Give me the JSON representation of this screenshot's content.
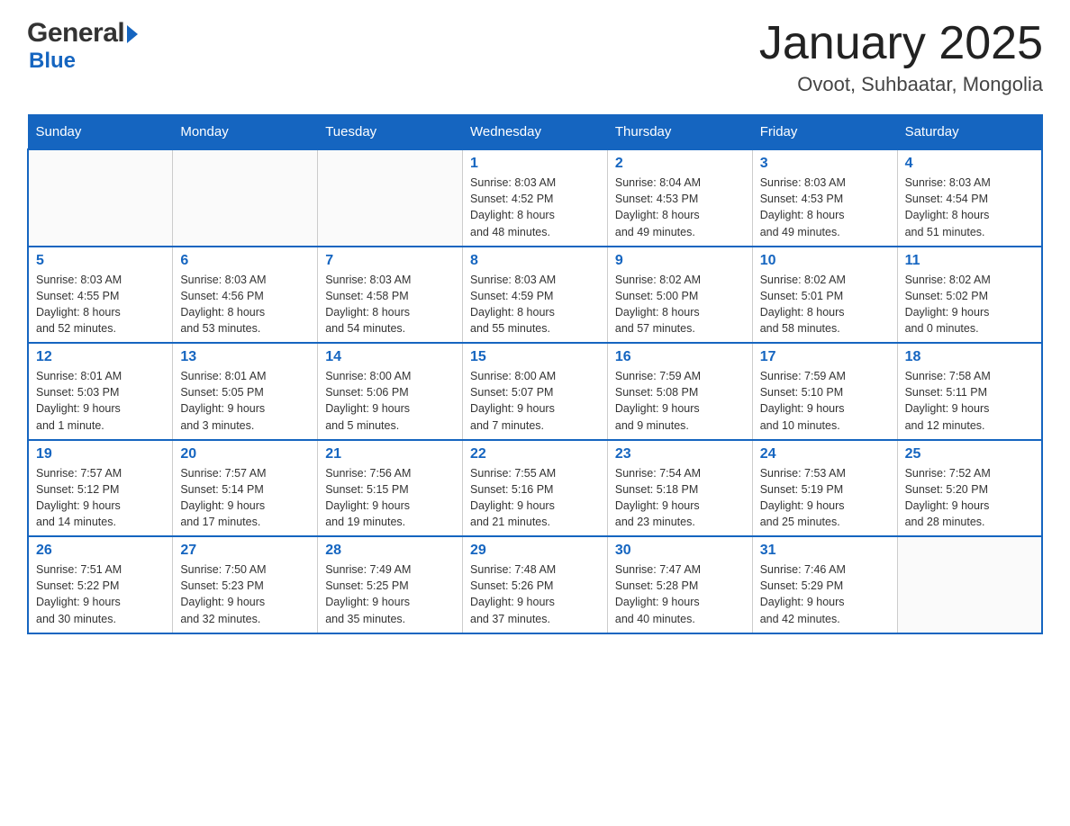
{
  "logo": {
    "general": "General",
    "blue": "Blue"
  },
  "title": "January 2025",
  "location": "Ovoot, Suhbaatar, Mongolia",
  "weekdays": [
    "Sunday",
    "Monday",
    "Tuesday",
    "Wednesday",
    "Thursday",
    "Friday",
    "Saturday"
  ],
  "weeks": [
    [
      {
        "day": "",
        "info": ""
      },
      {
        "day": "",
        "info": ""
      },
      {
        "day": "",
        "info": ""
      },
      {
        "day": "1",
        "info": "Sunrise: 8:03 AM\nSunset: 4:52 PM\nDaylight: 8 hours\nand 48 minutes."
      },
      {
        "day": "2",
        "info": "Sunrise: 8:04 AM\nSunset: 4:53 PM\nDaylight: 8 hours\nand 49 minutes."
      },
      {
        "day": "3",
        "info": "Sunrise: 8:03 AM\nSunset: 4:53 PM\nDaylight: 8 hours\nand 49 minutes."
      },
      {
        "day": "4",
        "info": "Sunrise: 8:03 AM\nSunset: 4:54 PM\nDaylight: 8 hours\nand 51 minutes."
      }
    ],
    [
      {
        "day": "5",
        "info": "Sunrise: 8:03 AM\nSunset: 4:55 PM\nDaylight: 8 hours\nand 52 minutes."
      },
      {
        "day": "6",
        "info": "Sunrise: 8:03 AM\nSunset: 4:56 PM\nDaylight: 8 hours\nand 53 minutes."
      },
      {
        "day": "7",
        "info": "Sunrise: 8:03 AM\nSunset: 4:58 PM\nDaylight: 8 hours\nand 54 minutes."
      },
      {
        "day": "8",
        "info": "Sunrise: 8:03 AM\nSunset: 4:59 PM\nDaylight: 8 hours\nand 55 minutes."
      },
      {
        "day": "9",
        "info": "Sunrise: 8:02 AM\nSunset: 5:00 PM\nDaylight: 8 hours\nand 57 minutes."
      },
      {
        "day": "10",
        "info": "Sunrise: 8:02 AM\nSunset: 5:01 PM\nDaylight: 8 hours\nand 58 minutes."
      },
      {
        "day": "11",
        "info": "Sunrise: 8:02 AM\nSunset: 5:02 PM\nDaylight: 9 hours\nand 0 minutes."
      }
    ],
    [
      {
        "day": "12",
        "info": "Sunrise: 8:01 AM\nSunset: 5:03 PM\nDaylight: 9 hours\nand 1 minute."
      },
      {
        "day": "13",
        "info": "Sunrise: 8:01 AM\nSunset: 5:05 PM\nDaylight: 9 hours\nand 3 minutes."
      },
      {
        "day": "14",
        "info": "Sunrise: 8:00 AM\nSunset: 5:06 PM\nDaylight: 9 hours\nand 5 minutes."
      },
      {
        "day": "15",
        "info": "Sunrise: 8:00 AM\nSunset: 5:07 PM\nDaylight: 9 hours\nand 7 minutes."
      },
      {
        "day": "16",
        "info": "Sunrise: 7:59 AM\nSunset: 5:08 PM\nDaylight: 9 hours\nand 9 minutes."
      },
      {
        "day": "17",
        "info": "Sunrise: 7:59 AM\nSunset: 5:10 PM\nDaylight: 9 hours\nand 10 minutes."
      },
      {
        "day": "18",
        "info": "Sunrise: 7:58 AM\nSunset: 5:11 PM\nDaylight: 9 hours\nand 12 minutes."
      }
    ],
    [
      {
        "day": "19",
        "info": "Sunrise: 7:57 AM\nSunset: 5:12 PM\nDaylight: 9 hours\nand 14 minutes."
      },
      {
        "day": "20",
        "info": "Sunrise: 7:57 AM\nSunset: 5:14 PM\nDaylight: 9 hours\nand 17 minutes."
      },
      {
        "day": "21",
        "info": "Sunrise: 7:56 AM\nSunset: 5:15 PM\nDaylight: 9 hours\nand 19 minutes."
      },
      {
        "day": "22",
        "info": "Sunrise: 7:55 AM\nSunset: 5:16 PM\nDaylight: 9 hours\nand 21 minutes."
      },
      {
        "day": "23",
        "info": "Sunrise: 7:54 AM\nSunset: 5:18 PM\nDaylight: 9 hours\nand 23 minutes."
      },
      {
        "day": "24",
        "info": "Sunrise: 7:53 AM\nSunset: 5:19 PM\nDaylight: 9 hours\nand 25 minutes."
      },
      {
        "day": "25",
        "info": "Sunrise: 7:52 AM\nSunset: 5:20 PM\nDaylight: 9 hours\nand 28 minutes."
      }
    ],
    [
      {
        "day": "26",
        "info": "Sunrise: 7:51 AM\nSunset: 5:22 PM\nDaylight: 9 hours\nand 30 minutes."
      },
      {
        "day": "27",
        "info": "Sunrise: 7:50 AM\nSunset: 5:23 PM\nDaylight: 9 hours\nand 32 minutes."
      },
      {
        "day": "28",
        "info": "Sunrise: 7:49 AM\nSunset: 5:25 PM\nDaylight: 9 hours\nand 35 minutes."
      },
      {
        "day": "29",
        "info": "Sunrise: 7:48 AM\nSunset: 5:26 PM\nDaylight: 9 hours\nand 37 minutes."
      },
      {
        "day": "30",
        "info": "Sunrise: 7:47 AM\nSunset: 5:28 PM\nDaylight: 9 hours\nand 40 minutes."
      },
      {
        "day": "31",
        "info": "Sunrise: 7:46 AM\nSunset: 5:29 PM\nDaylight: 9 hours\nand 42 minutes."
      },
      {
        "day": "",
        "info": ""
      }
    ]
  ]
}
